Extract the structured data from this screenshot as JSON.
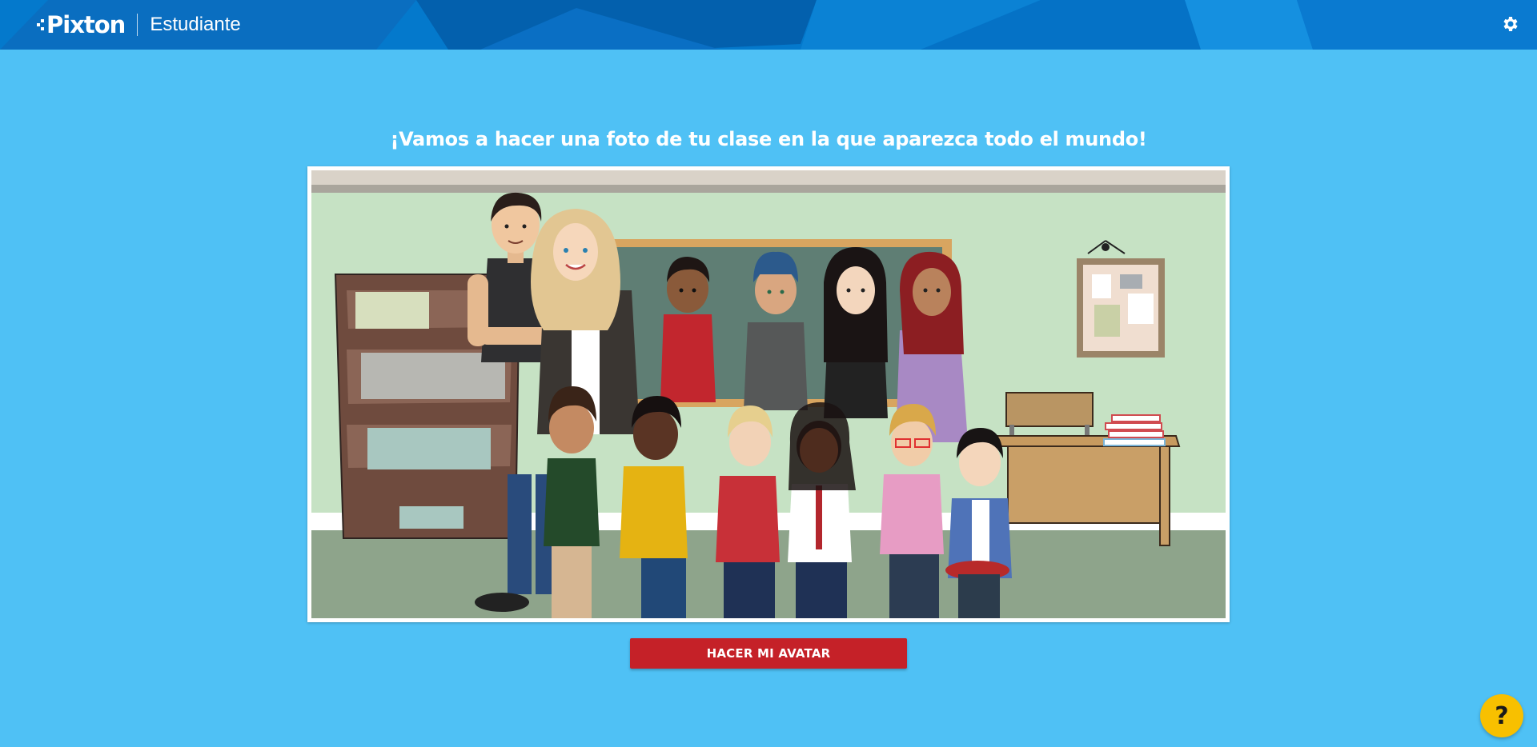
{
  "header": {
    "logo_text": "Pixton",
    "subtitle": "Estudiante",
    "settings_icon": "gear-icon",
    "colors": {
      "bar": "#0479cc",
      "bar_dark": "#0364b0",
      "bar_light": "#1592e0"
    }
  },
  "main": {
    "headline": "¡Vamos a hacer una foto de tu clase en la que aparezca todo el mundo!",
    "illustration": "class-photo-illustration",
    "button_label": "HACER MI AVATAR"
  },
  "help": {
    "label": "?",
    "icon": "help-icon"
  },
  "colors": {
    "page_background": "#4fc1f5",
    "button": "#c52128",
    "help_button": "#f8c000"
  }
}
